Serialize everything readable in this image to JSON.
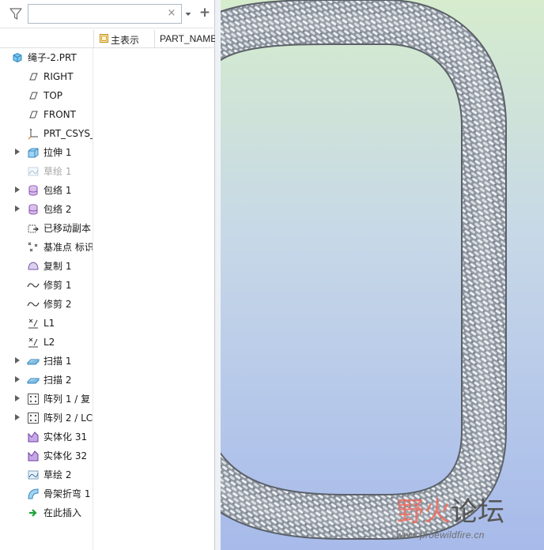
{
  "search": {
    "placeholder": "",
    "value": "",
    "clear_glyph": "×"
  },
  "toolbar": {
    "filter_icon": "filter-icon",
    "dropdown_icon": "chevron-down-icon",
    "add_glyph": "+"
  },
  "columns": {
    "display": "主表示",
    "part_name": "PART_NAME"
  },
  "tree": {
    "root": {
      "label": "绳子-2.PRT",
      "icon": "part-icon"
    },
    "items": [
      {
        "label": "RIGHT",
        "icon": "datum-plane-icon",
        "expandable": false,
        "dim": false
      },
      {
        "label": "TOP",
        "icon": "datum-plane-icon",
        "expandable": false,
        "dim": false
      },
      {
        "label": "FRONT",
        "icon": "datum-plane-icon",
        "expandable": false,
        "dim": false
      },
      {
        "label": "PRT_CSYS_",
        "icon": "csys-icon",
        "expandable": false,
        "dim": false
      },
      {
        "label": "拉伸 1",
        "icon": "extrude-icon",
        "expandable": true,
        "dim": false
      },
      {
        "label": "草绘 1",
        "icon": "sketch-icon",
        "expandable": false,
        "dim": true
      },
      {
        "label": "包络 1",
        "icon": "wrap-icon",
        "expandable": true,
        "dim": false
      },
      {
        "label": "包络 2",
        "icon": "wrap-icon",
        "expandable": true,
        "dim": false
      },
      {
        "label": "已移动副本",
        "icon": "moved-copy-icon",
        "expandable": false,
        "dim": false
      },
      {
        "label": "基准点 标识",
        "icon": "datum-point-icon",
        "expandable": false,
        "dim": false
      },
      {
        "label": "复制 1",
        "icon": "copy-icon",
        "expandable": false,
        "dim": false
      },
      {
        "label": "修剪 1",
        "icon": "trim-icon",
        "expandable": false,
        "dim": false
      },
      {
        "label": "修剪 2",
        "icon": "trim-icon",
        "expandable": false,
        "dim": false
      },
      {
        "label": "L1",
        "icon": "parameter-icon",
        "expandable": false,
        "dim": false
      },
      {
        "label": "L2",
        "icon": "parameter-icon",
        "expandable": false,
        "dim": false
      },
      {
        "label": "扫描 1",
        "icon": "sweep-icon",
        "expandable": true,
        "dim": false
      },
      {
        "label": "扫描 2",
        "icon": "sweep-icon",
        "expandable": true,
        "dim": false
      },
      {
        "label": "阵列 1 / 复",
        "icon": "pattern-icon",
        "expandable": true,
        "dim": false
      },
      {
        "label": "阵列 2 / LC",
        "icon": "pattern-icon",
        "expandable": true,
        "dim": false
      },
      {
        "label": "实体化 31",
        "icon": "solidify-icon",
        "expandable": false,
        "dim": false
      },
      {
        "label": "实体化 32",
        "icon": "solidify-icon",
        "expandable": false,
        "dim": false
      },
      {
        "label": "草绘 2",
        "icon": "sketch-icon",
        "expandable": false,
        "dim": false
      },
      {
        "label": "骨架折弯 1",
        "icon": "spinal-bend-icon",
        "expandable": false,
        "dim": false
      },
      {
        "label": "在此插入",
        "icon": "insert-here-icon",
        "expandable": false,
        "dim": false
      }
    ]
  },
  "watermark": {
    "brand_a": "野火",
    "brand_b": "论坛",
    "url": "www.proewildfire.cn"
  },
  "colors": {
    "braid_base": "#8d949d",
    "braid_highlight": "#f4f6f8",
    "viewport_top": "#d6eccd",
    "viewport_bottom": "#a7baea"
  }
}
